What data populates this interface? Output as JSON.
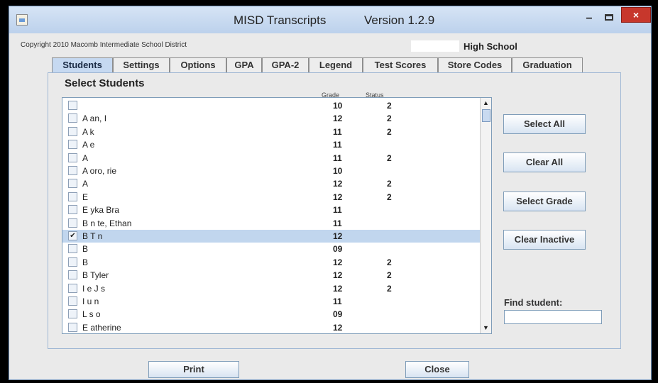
{
  "window": {
    "title": "MISD Transcripts",
    "version": "Version 1.2.9",
    "minimize_glyph": "−",
    "close_glyph": "×"
  },
  "header": {
    "copyright": "Copyright 2010 Macomb Intermediate School District",
    "school_label": "High School"
  },
  "tabs": [
    {
      "label": "Students",
      "active": true
    },
    {
      "label": "Settings"
    },
    {
      "label": "Options"
    },
    {
      "label": "GPA"
    },
    {
      "label": "GPA-2"
    },
    {
      "label": "Legend"
    },
    {
      "label": "Test Scores"
    },
    {
      "label": "Store Codes"
    },
    {
      "label": "Graduation"
    }
  ],
  "students_panel": {
    "heading": "Select Students",
    "columns": {
      "grade": "Grade",
      "status": "Status"
    },
    "rows": [
      {
        "name": "",
        "grade": "10",
        "status": "2",
        "checked": false
      },
      {
        "name": "A          an, I",
        "grade": "12",
        "status": "2",
        "checked": false
      },
      {
        "name": "A  k",
        "grade": "11",
        "status": "2",
        "checked": false
      },
      {
        "name": "A  e",
        "grade": "11",
        "status": "",
        "checked": false
      },
      {
        "name": "A",
        "grade": "11",
        "status": "2",
        "checked": false
      },
      {
        "name": "A  oro,         rie",
        "grade": "10",
        "status": "",
        "checked": false
      },
      {
        "name": "A",
        "grade": "12",
        "status": "2",
        "checked": false
      },
      {
        "name": "E",
        "grade": "12",
        "status": "2",
        "checked": false
      },
      {
        "name": "E  yka  Bra",
        "grade": "11",
        "status": "",
        "checked": false
      },
      {
        "name": "B  n  te, Ethan",
        "grade": "11",
        "status": "",
        "checked": false
      },
      {
        "name": "B  T              n",
        "grade": "12",
        "status": "",
        "checked": true,
        "selected": true
      },
      {
        "name": "B",
        "grade": "09",
        "status": "",
        "checked": false
      },
      {
        "name": "B",
        "grade": "12",
        "status": "2",
        "checked": false
      },
      {
        "name": "B               Tyler",
        "grade": "12",
        "status": "2",
        "checked": false
      },
      {
        "name": "I  e        J      s",
        "grade": "12",
        "status": "2",
        "checked": false
      },
      {
        "name": "I  u              n",
        "grade": "11",
        "status": "",
        "checked": false
      },
      {
        "name": "L  s          o",
        "grade": "09",
        "status": "",
        "checked": false
      },
      {
        "name": "E                  atherine",
        "grade": "12",
        "status": "",
        "checked": false
      }
    ],
    "check_glyph": "✔",
    "scroll_up_glyph": "▲",
    "scroll_down_glyph": "▼"
  },
  "actions": {
    "select_all": "Select All",
    "clear_all": "Clear All",
    "select_grade": "Select Grade",
    "clear_inactive": "Clear Inactive"
  },
  "find": {
    "label": "Find student:",
    "value": ""
  },
  "footer": {
    "print": "Print",
    "close": "Close"
  }
}
